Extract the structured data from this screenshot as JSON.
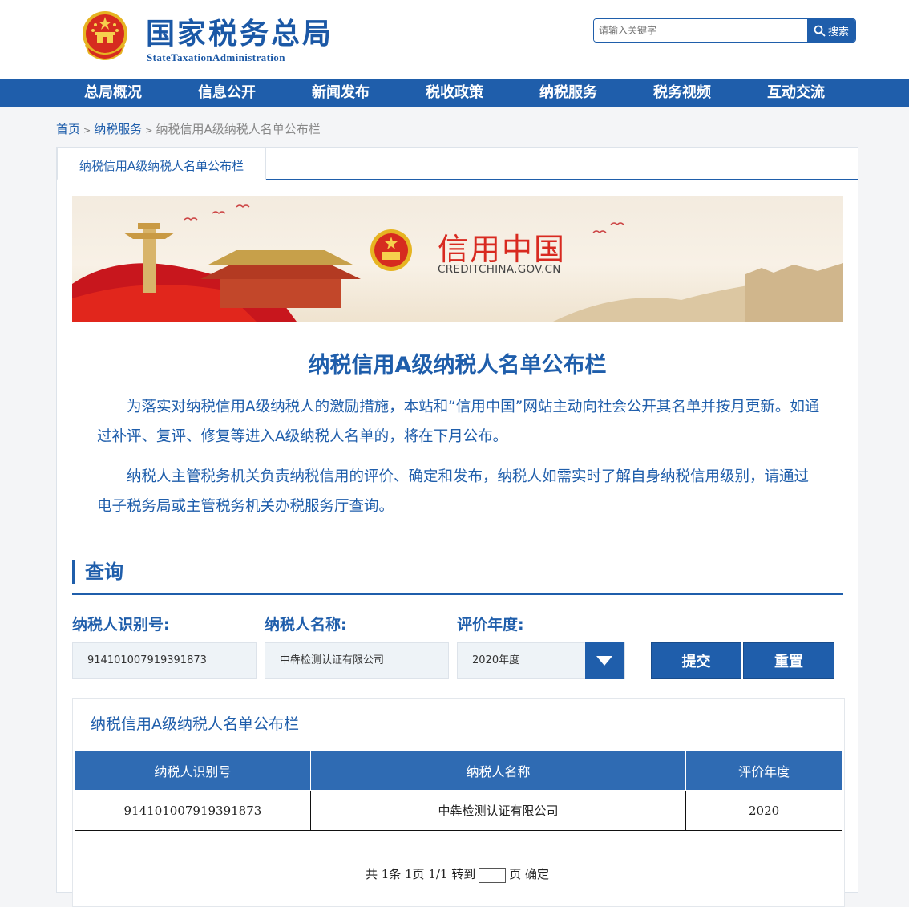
{
  "header": {
    "site_name": "国家税务总局",
    "site_en": "StateTaxationAdministration",
    "search_placeholder": "请输入关键字",
    "search_button": "搜索"
  },
  "nav": [
    "总局概况",
    "信息公开",
    "新闻发布",
    "税收政策",
    "纳税服务",
    "税务视频",
    "互动交流"
  ],
  "breadcrumb": {
    "home": "首页",
    "section": "纳税服务",
    "current": "纳税信用A级纳税人名单公布栏",
    "separator": ">"
  },
  "tab": "纳税信用A级纳税人名单公布栏",
  "banner": {
    "title": "信用中国",
    "subtitle": "CREDITCHINA.GOV.CN"
  },
  "main_title": "纳税信用A级纳税人名单公布栏",
  "paragraphs": [
    "为落实对纳税信用A级纳税人的激励措施，本站和“信用中国”网站主动向社会公开其名单并按月更新。如通过补评、复评、修复等进入A级纳税人名单的，将在下月公布。",
    "纳税人主管税务机关负责纳税信用的评价、确定和发布，纳税人如需实时了解自身纳税信用级别，请通过电子税务局或主管税务机关办税服务厅查询。"
  ],
  "query": {
    "title": "查询",
    "labels": {
      "tax_id": "纳税人识别号:",
      "name": "纳税人名称:",
      "year": "评价年度:"
    },
    "values": {
      "tax_id": "914101007919391873",
      "name": "中犇检测认证有限公司",
      "year": "2020年度"
    },
    "buttons": {
      "submit": "提交",
      "reset": "重置"
    }
  },
  "results": {
    "title": "纳税信用A级纳税人名单公布栏",
    "columns": [
      "纳税人识别号",
      "纳税人名称",
      "评价年度"
    ],
    "rows": [
      [
        "914101007919391873",
        "中犇检测认证有限公司",
        "2020"
      ]
    ]
  },
  "pager": {
    "summary": "共 1条 1页 1/1 转到",
    "page_unit": "页",
    "confirm": "确定"
  },
  "colors": {
    "primary": "#1f5eab",
    "table_header": "#2f6bb3",
    "banner_red": "#d82a20"
  }
}
